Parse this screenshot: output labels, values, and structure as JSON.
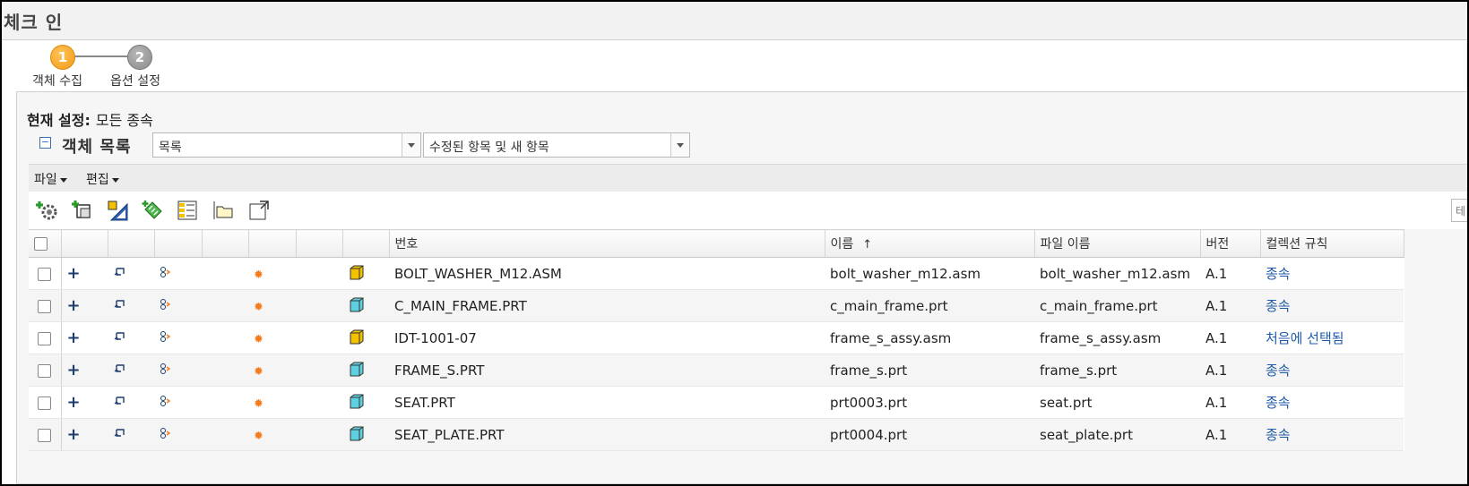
{
  "window": {
    "title": "체크 인"
  },
  "steps": [
    {
      "number": "1",
      "label": "객체 수집",
      "state": "active"
    },
    {
      "number": "2",
      "label": "옵션 설정",
      "state": "inactive"
    }
  ],
  "current_setting": {
    "label": "현재 설정:",
    "value": "모든 종속"
  },
  "object_list": {
    "label": "객체 목록",
    "view_select": "목록",
    "filter_select": "수정된 항목 및 새 항목"
  },
  "menus": {
    "file": "파일",
    "edit": "편집"
  },
  "toolbar_icons": [
    "auto-collect-icon",
    "add-object-icon",
    "set-rule-icon",
    "collect-dependents-icon",
    "table-view-icon",
    "folder-location-icon",
    "new-window-icon"
  ],
  "search_placeholder": "테",
  "table": {
    "columns": [
      "번호",
      "이름",
      "파일 이름",
      "버전",
      "컬렉션 규칙"
    ],
    "sort_indicator": "↑",
    "rows": [
      {
        "number": "BOLT_WASHER_M12.ASM",
        "name": "bolt_washer_m12.asm",
        "file": "bolt_washer_m12.asm",
        "version": "A.1",
        "rule": "종속",
        "type": "assembly"
      },
      {
        "number": "C_MAIN_FRAME.PRT",
        "name": "c_main_frame.prt",
        "file": "c_main_frame.prt",
        "version": "A.1",
        "rule": "종속",
        "type": "part"
      },
      {
        "number": "IDT-1001-07",
        "name": "frame_s_assy.asm",
        "file": "frame_s_assy.asm",
        "version": "A.1",
        "rule": "처음에 선택됨",
        "type": "assembly"
      },
      {
        "number": "FRAME_S.PRT",
        "name": "frame_s.prt",
        "file": "frame_s.prt",
        "version": "A.1",
        "rule": "종속",
        "type": "part"
      },
      {
        "number": "SEAT.PRT",
        "name": "prt0003.prt",
        "file": "seat.prt",
        "version": "A.1",
        "rule": "종속",
        "type": "part"
      },
      {
        "number": "SEAT_PLATE.PRT",
        "name": "prt0004.prt",
        "file": "seat_plate.prt",
        "version": "A.1",
        "rule": "종속",
        "type": "part"
      }
    ]
  },
  "colors": {
    "active_step": "#f39a14",
    "link": "#1f5ba8",
    "assembly_icon": "#f2c200",
    "part_icon": "#5fd0e0"
  }
}
